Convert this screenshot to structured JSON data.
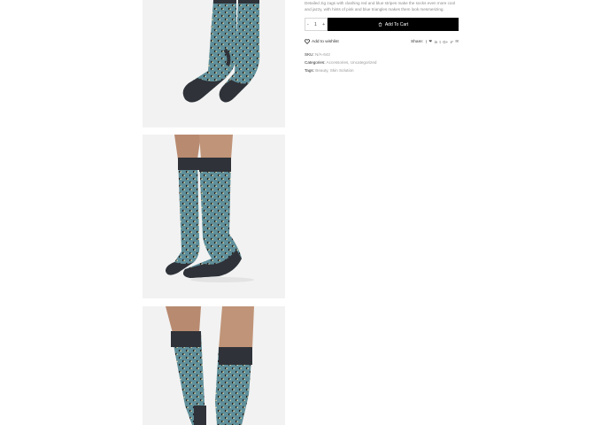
{
  "product": {
    "description": "Detailed zig zags with clashing red and blue stripes make the socks even more cool and jazzy, with hints of pink and blue triangles makes them look mesmerizing.",
    "quantity": {
      "minus": "-",
      "value": "1",
      "plus": "+"
    },
    "add_to_cart_label": "Add To Cart",
    "wishlist_label": "Add to wishlist",
    "share_label": "Share:",
    "share_icons": [
      "f",
      "❤",
      "in",
      "t",
      "G+",
      "℘",
      "✉"
    ],
    "sku_label": "SKU:",
    "sku_value": "N/A-642",
    "categories_label": "Categories:",
    "categories_value": "Accessories, Uncategorized",
    "tags_label": "Tags:",
    "tags_value": "Beauty, Skin Solution"
  },
  "colors": {
    "sock_teal": "#5f8f9a",
    "sock_dark": "#2f3238",
    "photo_bg": "#f2f2f2",
    "button_bg": "#000000"
  },
  "icons": {
    "cart": "bag-icon",
    "wishlist": "heart-icon",
    "share": [
      "facebook-icon",
      "twitter-icon",
      "linkedin-icon",
      "tumblr-icon",
      "google-plus-icon",
      "pinterest-icon",
      "email-icon"
    ]
  }
}
